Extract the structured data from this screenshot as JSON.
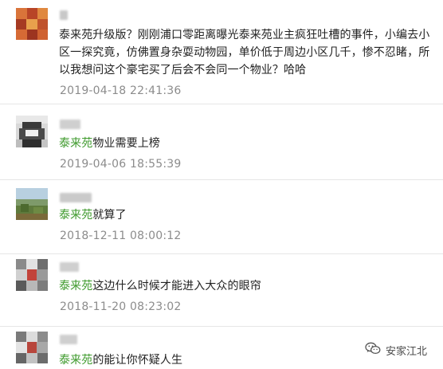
{
  "comments": [
    {
      "highlight": "",
      "text": "泰来苑升级版？刚刚浦口零距离曝光泰来苑业主疯狂吐槽的事件，小编去小区一探究竟，仿佛置身杂耍动物园，单价低于周边小区几千，惨不忍睹，所以我想问这个豪宅买了后会不会同一个物业？哈哈",
      "timestamp": "2019-04-18 22:41:36"
    },
    {
      "highlight": "泰来苑",
      "text": "物业需要上榜",
      "timestamp": "2019-04-06 18:55:39"
    },
    {
      "highlight": "泰来苑",
      "text": "就算了",
      "timestamp": "2018-12-11 08:00:12"
    },
    {
      "highlight": "泰来苑",
      "text": "这边什么时候才能进入大众的眼帘",
      "timestamp": "2018-11-20 08:23:02"
    },
    {
      "highlight": "泰来苑",
      "text": "的能让你怀疑人生",
      "timestamp": ""
    }
  ],
  "watermark": {
    "text": "安家江北",
    "icon": "wechat-icon"
  },
  "colors": {
    "highlight": "#3e9a2c",
    "text": "#222222",
    "timestamp": "#8c8c8c",
    "divider": "#e6e6e6"
  }
}
